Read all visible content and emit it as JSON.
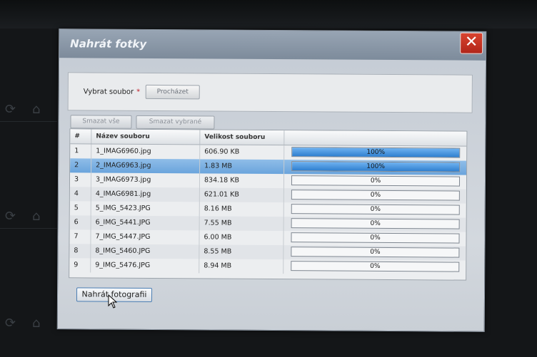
{
  "dialog": {
    "title": "Nahrát fotky",
    "close_symbol": "✕",
    "file_select": {
      "label": "Vybrat soubor",
      "required_marker": "*",
      "browse_label": "Procházet"
    },
    "actions": {
      "clear_all_label": "Smazat vše",
      "clear_selected_label": "Smazat vybrané"
    },
    "table": {
      "headers": [
        "#",
        "Název souboru",
        "Velikost souboru",
        ""
      ],
      "rows": [
        {
          "num": "1",
          "name": "1_IMAG6960.jpg",
          "size": "606.90 KB",
          "progress": 100,
          "progress_label": "100%"
        },
        {
          "num": "2",
          "name": "2_IMAG6963.jpg",
          "size": "1.83 MB",
          "progress": 100,
          "progress_label": "100%",
          "selected": true
        },
        {
          "num": "3",
          "name": "3_IMAG6973.jpg",
          "size": "834.18 KB",
          "progress": 0,
          "progress_label": "0%"
        },
        {
          "num": "4",
          "name": "4_IMAG6981.jpg",
          "size": "621.01 KB",
          "progress": 0,
          "progress_label": "0%"
        },
        {
          "num": "5",
          "name": "5_IMG_5423.JPG",
          "size": "8.16 MB",
          "progress": 0,
          "progress_label": "0%"
        },
        {
          "num": "6",
          "name": "6_IMG_5441.JPG",
          "size": "7.55 MB",
          "progress": 0,
          "progress_label": "0%"
        },
        {
          "num": "7",
          "name": "7_IMG_5447.JPG",
          "size": "6.00 MB",
          "progress": 0,
          "progress_label": "0%"
        },
        {
          "num": "8",
          "name": "8_IMG_5460.JPG",
          "size": "8.55 MB",
          "progress": 0,
          "progress_label": "0%"
        },
        {
          "num": "9",
          "name": "9_IMG_5476.JPG",
          "size": "8.94 MB",
          "progress": 0,
          "progress_label": "0%"
        }
      ]
    },
    "upload_label": "Nahrát fotografii"
  },
  "background_icons": [
    "refresh-icon",
    "home-icon"
  ],
  "colors": {
    "accent": "#2f7fcf",
    "selection": "#7aaee0",
    "close": "#c0331f"
  }
}
